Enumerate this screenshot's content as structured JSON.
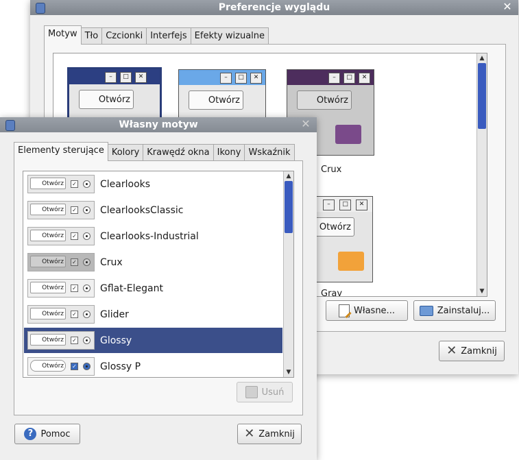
{
  "back_window": {
    "title": "Preferencje wyglądu",
    "tabs": [
      "Motyw",
      "Tło",
      "Czcionki",
      "Interfejs",
      "Efekty wizualne"
    ],
    "thumbnails": [
      {
        "button": "Otwórz",
        "label": ""
      },
      {
        "button": "Otwórz",
        "label": ""
      },
      {
        "button": "Otwórz",
        "label": "Crux"
      },
      {
        "button": "Otwórz",
        "label": "Gray"
      }
    ],
    "buttons": {
      "custom": "Własne...",
      "install": "Zainstaluj...",
      "close": "Zamknij"
    }
  },
  "front_window": {
    "title": "Własny motyw",
    "tabs": [
      "Elementy sterujące",
      "Kolory",
      "Krawędź okna",
      "Ikony",
      "Wskaźnik"
    ],
    "themes": [
      {
        "name": "Clearlooks",
        "preview": "Otwórz"
      },
      {
        "name": "ClearlooksClassic",
        "preview": "Otwórz"
      },
      {
        "name": "Clearlooks-Industrial",
        "preview": "Otwórz"
      },
      {
        "name": "Crux",
        "preview": "Otwórz"
      },
      {
        "name": "Gflat-Elegant",
        "preview": "Otwórz"
      },
      {
        "name": "Glider",
        "preview": "Otwórz"
      },
      {
        "name": "Glossy",
        "preview": "Otwórz",
        "selected": true
      },
      {
        "name": "Glossy P",
        "preview": "Otwórz"
      }
    ],
    "buttons": {
      "remove": "Usuń",
      "help": "Pomoc",
      "close": "Zamknij"
    }
  },
  "colors": {
    "selection": "#3b4f8a",
    "scroll_thumb": "#3a5bbf",
    "titlebar": "#8a9098"
  }
}
